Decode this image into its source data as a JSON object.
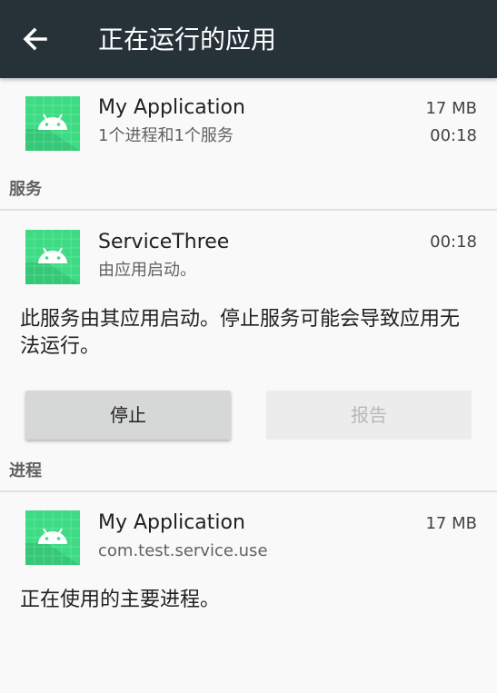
{
  "toolbar": {
    "title": "正在运行的应用",
    "back_icon": "arrow-back-icon",
    "background": "#263238"
  },
  "app_summary": {
    "name": "My Application",
    "detail": "1个进程和1个服务",
    "memory": "17 MB",
    "time": "00:18",
    "icon": "android-icon"
  },
  "services_section": {
    "header": "服务"
  },
  "service": {
    "name": "ServiceThree",
    "detail": "由应用启动。",
    "time": "00:18",
    "icon": "android-icon",
    "description": "此服务由其应用启动。停止服务可能会导致应用无法运行。",
    "stop_label": "停止",
    "report_label": "报告"
  },
  "processes_section": {
    "header": "进程"
  },
  "process": {
    "name": "My Application",
    "package": "com.test.service.use",
    "memory": "17 MB",
    "icon": "android-icon",
    "description": "正在使用的主要进程。"
  },
  "colors": {
    "icon_green": "#3ddc84",
    "icon_dark_green": "#2fb86f"
  }
}
